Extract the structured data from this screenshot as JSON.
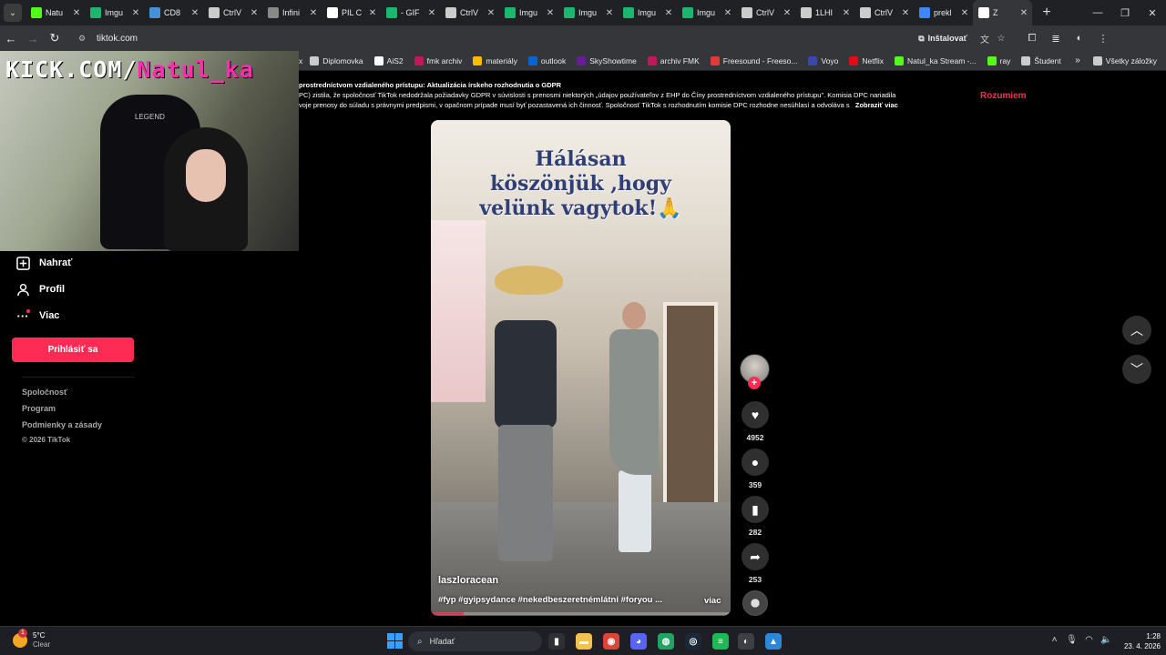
{
  "browser": {
    "tabs": [
      {
        "label": "Natu",
        "icon": "kick-icon",
        "color": "#53fc18"
      },
      {
        "label": "Imgu",
        "icon": "imgur-icon",
        "color": "#1bb76e"
      },
      {
        "label": "CD8",
        "icon": "cd-icon",
        "color": "#4a90d9"
      },
      {
        "label": "CtrlV",
        "icon": "ctrlv-icon",
        "color": "#cccccc"
      },
      {
        "label": "Infini",
        "icon": "globe-icon",
        "color": "#888888"
      },
      {
        "label": "PIL C",
        "icon": "pil-icon",
        "color": "#ffffff"
      },
      {
        "label": "- GIF",
        "icon": "gif-icon",
        "color": "#1bb76e"
      },
      {
        "label": "CtrlV",
        "icon": "ctrlv-icon",
        "color": "#cccccc"
      },
      {
        "label": "Imgu",
        "icon": "imgur-icon",
        "color": "#1bb76e"
      },
      {
        "label": "Imgu",
        "icon": "imgur-icon",
        "color": "#1bb76e"
      },
      {
        "label": "Imgu",
        "icon": "imgur-icon",
        "color": "#1bb76e"
      },
      {
        "label": "Imgu",
        "icon": "imgur-icon",
        "color": "#1bb76e"
      },
      {
        "label": "CtrlV",
        "icon": "ctrlv-icon",
        "color": "#cccccc"
      },
      {
        "label": "1LHI",
        "icon": "ctrlv-icon",
        "color": "#cccccc"
      },
      {
        "label": "CtrlV",
        "icon": "ctrlv-icon",
        "color": "#cccccc"
      },
      {
        "label": "prekl",
        "icon": "google-icon",
        "color": "#4285f4"
      },
      {
        "label": "Z",
        "icon": "tiktok-icon",
        "color": "#ffffff",
        "active": true
      }
    ],
    "url": "tiktok.com",
    "install_label": "Inštalovať",
    "bookmarks": [
      {
        "label": "Diplomovka",
        "icon": "folder-icon",
        "color": "#cccccc"
      },
      {
        "label": "AiS2",
        "icon": "ais-icon",
        "color": "#ffffff"
      },
      {
        "label": "fmk archiv",
        "icon": "fmk-icon",
        "color": "#c2185b"
      },
      {
        "label": "materiály",
        "icon": "drive-icon",
        "color": "#fbbc04"
      },
      {
        "label": "outlook",
        "icon": "outlook-icon",
        "color": "#0a64d6"
      },
      {
        "label": "SkyShowtime",
        "icon": "sky-icon",
        "color": "#6a1b9a"
      },
      {
        "label": "archiv FMK",
        "icon": "fmk-icon",
        "color": "#c2185b"
      },
      {
        "label": "Freesound - Freeso...",
        "icon": "freesound-icon",
        "color": "#e53935"
      },
      {
        "label": "Voyo",
        "icon": "voyo-icon",
        "color": "#3949ab"
      },
      {
        "label": "Netflix",
        "icon": "netflix-icon",
        "color": "#e50914"
      },
      {
        "label": "Natul_ka Stream -...",
        "icon": "kick-icon",
        "color": "#53fc18"
      },
      {
        "label": "ray",
        "icon": "kick-icon",
        "color": "#53fc18"
      },
      {
        "label": "Študent",
        "icon": "student-icon",
        "color": "#cccccc"
      }
    ],
    "all_bookmarks_label": "Všetky záložky"
  },
  "gdpr": {
    "line1": "prostredníctvom vzdialeného prístupu: Aktualizácia írskeho rozhodnutia o GDPR",
    "line2": "PC) zistila, že spoločnosť TikTok nedodržala požiadavky GDPR v súvislosti s prenosmi niektorých „údajov používateľov z EHP do Číny prostredníctvom vzdialeného prístupu\". Komisia DPC nariadila",
    "line3": "voje prenosy do súladu s právnymi predpismi, v opačnom prípade musí byť pozastavená ich činnosť. Spoločnosť TikTok s rozhodnutím komisie DPC rozhodne nesúhlasí a odvoláva s",
    "more_label": "Zobraziť viac",
    "accept_label": "Rozumiem",
    "left_fragment": "x"
  },
  "webcam": {
    "overlay_prefix": "KICK.COM/",
    "overlay_name": "Natul_ka",
    "chair_logo": "LEGEND"
  },
  "sidebar": {
    "upload": "Nahrať",
    "profile": "Profil",
    "more": "Viac",
    "login": "Prihlásiť sa",
    "footer": [
      "Spoločnosť",
      "Program",
      "Podmienky a zásady"
    ],
    "copyright": "© 2026 TikTok"
  },
  "video": {
    "caption_lines": [
      "Hálásan",
      "köszönjük ,hogy",
      "velünk vagytok!🙏"
    ],
    "author": "laszloracean",
    "tags": "#fyp #gyipsydance #nekedbeszeretnémlátni #foryou ...",
    "more_label": "viac",
    "progress": 0.11
  },
  "actions": {
    "likes": "4952",
    "comments": "359",
    "saves": "282",
    "shares": "253"
  },
  "taskbar": {
    "temp": "5°C",
    "weather": "Clear",
    "weather_badge": "1",
    "search_placeholder": "Hľadať",
    "time": "1:28",
    "date": "23. 4. 2026",
    "apps": [
      {
        "name": "task-view-icon",
        "glyph": "▮",
        "color": "#2d3036"
      },
      {
        "name": "file-explorer-icon",
        "glyph": "▬",
        "color": "#f2c14e"
      },
      {
        "name": "chrome-icon",
        "glyph": "◉",
        "color": "#db4437"
      },
      {
        "name": "discord-icon",
        "glyph": "◕",
        "color": "#5865f2"
      },
      {
        "name": "whatsapp-icon",
        "glyph": "◍",
        "color": "#1fa463"
      },
      {
        "name": "steam-icon",
        "glyph": "◎",
        "color": "#1b2838"
      },
      {
        "name": "spotify-icon",
        "glyph": "≡",
        "color": "#1db954"
      },
      {
        "name": "obs-icon",
        "glyph": "◐",
        "color": "#3c3f44"
      },
      {
        "name": "photos-icon",
        "glyph": "▲",
        "color": "#2b88d8"
      }
    ]
  }
}
